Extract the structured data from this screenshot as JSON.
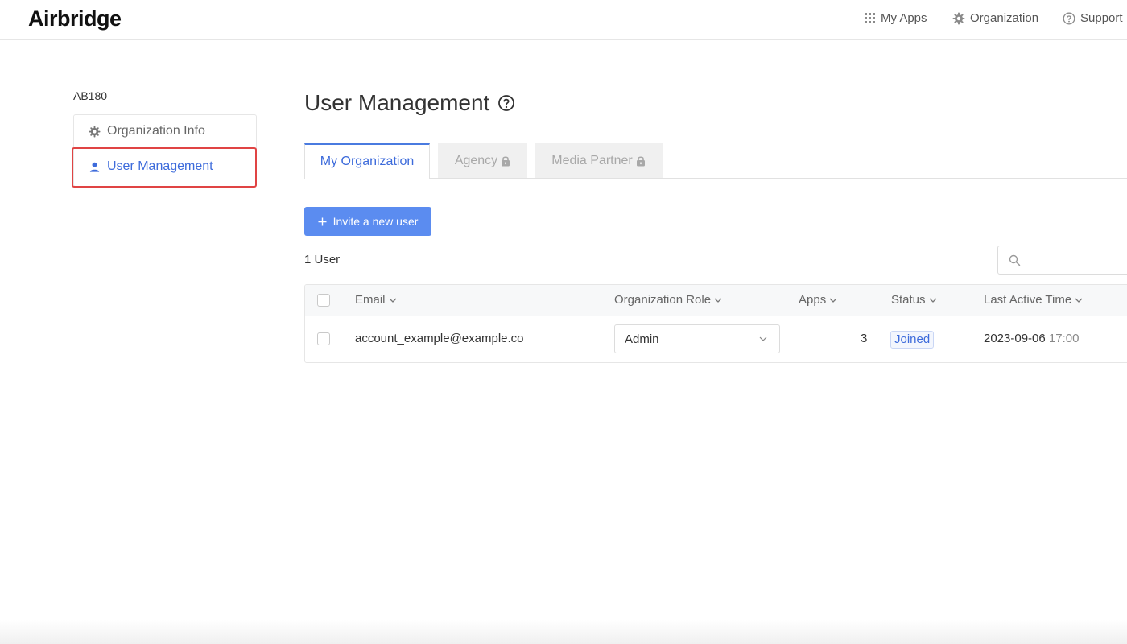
{
  "app": {
    "logo": "Airbridge"
  },
  "topnav": {
    "my_apps": "My Apps",
    "organization": "Organization",
    "support": "Support"
  },
  "sidebar": {
    "org_name": "AB180",
    "items": [
      {
        "label": "Organization Info",
        "icon": "gear-icon",
        "active": false
      },
      {
        "label": "User Management",
        "icon": "user-icon",
        "active": true
      }
    ]
  },
  "page": {
    "title": "User Management"
  },
  "tabs": [
    {
      "label": "My Organization",
      "locked": false,
      "active": true
    },
    {
      "label": "Agency",
      "locked": true,
      "active": false
    },
    {
      "label": "Media Partner",
      "locked": true,
      "active": false
    }
  ],
  "actions": {
    "invite_label": "Invite a new user"
  },
  "summary": {
    "user_count": "1 User"
  },
  "table": {
    "headers": {
      "email": "Email",
      "role": "Organization Role",
      "apps": "Apps",
      "status": "Status",
      "last_active": "Last Active Time"
    },
    "rows": [
      {
        "email": "account_example@example.co",
        "role": "Admin",
        "apps": "3",
        "status": "Joined",
        "last_active_date": "2023-09-06",
        "last_active_time": "17:00"
      }
    ]
  },
  "colors": {
    "accent": "#3d6bdb",
    "button": "#5b8cf0",
    "highlight": "#e04444"
  }
}
